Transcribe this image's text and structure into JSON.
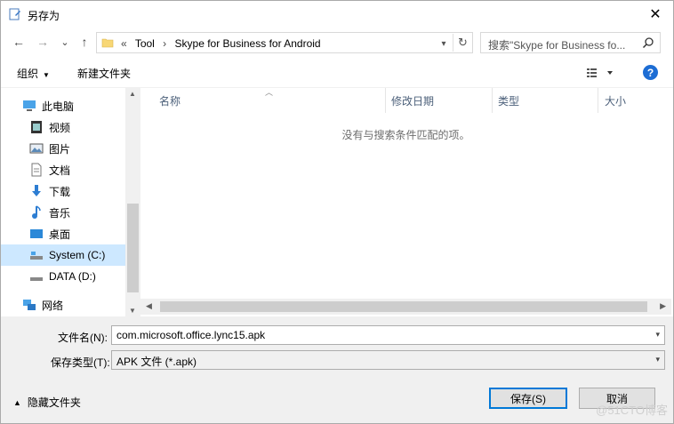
{
  "window": {
    "title": "另存为",
    "close": "✕"
  },
  "nav": {
    "back": "←",
    "forward": "→",
    "recent": "⌄",
    "up": "↑"
  },
  "address": {
    "prefix": "«",
    "crumbs": [
      "Tool",
      "›",
      "Skype for Business for Android"
    ]
  },
  "search": {
    "placeholder": "搜索\"Skype for Business fo..."
  },
  "toolbar": {
    "organize": "组织",
    "new_folder": "新建文件夹",
    "help": "?"
  },
  "sidebar": {
    "items": [
      {
        "label": "此电脑"
      },
      {
        "label": "视频"
      },
      {
        "label": "图片"
      },
      {
        "label": "文档"
      },
      {
        "label": "下载"
      },
      {
        "label": "音乐"
      },
      {
        "label": "桌面"
      },
      {
        "label": "System (C:)"
      },
      {
        "label": "DATA (D:)"
      },
      {
        "label": "网络"
      }
    ]
  },
  "columns": {
    "name": "名称",
    "modified": "修改日期",
    "type": "类型",
    "size": "大小"
  },
  "file_list": {
    "empty_message": "没有与搜索条件匹配的项。"
  },
  "form": {
    "filename_label": "文件名(N):",
    "filename_value": "com.microsoft.office.lync15.apk",
    "filetype_label": "保存类型(T):",
    "filetype_value": "APK 文件 (*.apk)"
  },
  "footer": {
    "hide_folders": "隐藏文件夹",
    "save": "保存(S)",
    "cancel": "取消"
  },
  "watermark": "@51CTO博客"
}
